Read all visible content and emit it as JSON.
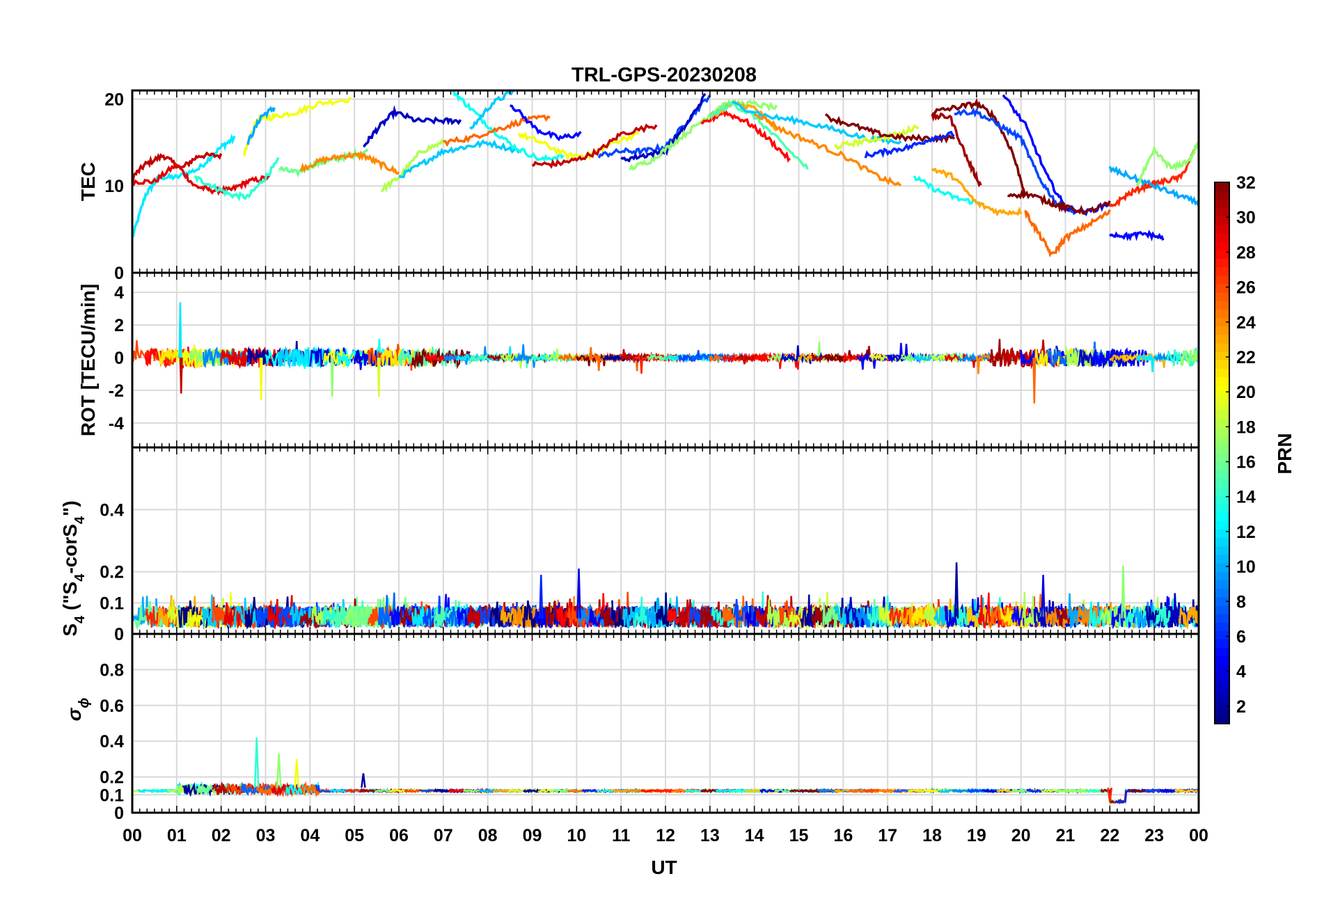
{
  "figure": {
    "title": "TRL-GPS-20230208",
    "xlabel": "UT"
  },
  "colorbar": {
    "label": "PRN",
    "ticks": [
      "2",
      "4",
      "6",
      "8",
      "10",
      "12",
      "14",
      "16",
      "18",
      "20",
      "22",
      "24",
      "26",
      "28",
      "30",
      "32"
    ],
    "min": 1,
    "max": 32,
    "colormap": "jet"
  },
  "x_ticks": [
    "00",
    "01",
    "02",
    "03",
    "04",
    "05",
    "06",
    "07",
    "08",
    "09",
    "10",
    "11",
    "12",
    "13",
    "14",
    "15",
    "16",
    "17",
    "18",
    "19",
    "20",
    "21",
    "22",
    "23",
    "00"
  ],
  "panels": [
    {
      "id": "tec",
      "ylabel": "TEC",
      "ylim": [
        0,
        21
      ],
      "yticks": [
        "0",
        "10",
        "20"
      ]
    },
    {
      "id": "rot",
      "ylabel": "ROT [TECU/min]",
      "ylim": [
        -5.5,
        5.2
      ],
      "yticks": [
        "-4",
        "-2",
        "0",
        "2",
        "4"
      ]
    },
    {
      "id": "s4",
      "ylabel_main": "S",
      "ylabel_sub": "4",
      "ylabel_rest": " (\"S",
      "ylabel_sub2": "4",
      "ylabel_rest2": "-corS",
      "ylabel_sub3": "4",
      "ylabel_end": "\")",
      "ylim": [
        0,
        0.6
      ],
      "yticks": [
        "0",
        "0.1",
        "0.2",
        "0.4"
      ]
    },
    {
      "id": "sigma",
      "ylabel": "σ",
      "ylabel_sub": "ϕ",
      "ylim": [
        0,
        1.0
      ],
      "yticks": [
        "0",
        "0.1",
        "0.2",
        "0.4",
        "0.6",
        "0.8"
      ]
    }
  ],
  "chart_data": [
    {
      "type": "line",
      "panel": "TEC",
      "xlabel": "",
      "ylabel": "TEC",
      "xlim": [
        0,
        24
      ],
      "ylim": [
        0,
        21
      ],
      "series": [
        {
          "prn": 12,
          "x": [
            0,
            0.3,
            0.6,
            1.0,
            1.5,
            2.0,
            2.3
          ],
          "values": [
            4,
            9,
            11,
            11,
            12,
            14.5,
            15.5
          ]
        },
        {
          "prn": 30,
          "x": [
            0,
            0.3,
            0.7,
            1.1,
            1.5,
            2.0
          ],
          "values": [
            11,
            12.5,
            13.5,
            12,
            13.5,
            13.5
          ]
        },
        {
          "prn": 29,
          "x": [
            0,
            0.5,
            1.0,
            1.4,
            1.8,
            2.2,
            2.6,
            3.1
          ],
          "values": [
            10.5,
            10.5,
            12.5,
            10,
            9.5,
            9.5,
            10.5,
            11
          ]
        },
        {
          "prn": 14,
          "x": [
            1.4,
            1.8,
            2.2,
            2.6,
            3.0,
            3.3
          ],
          "values": [
            11,
            10,
            9,
            8.7,
            11,
            13
          ]
        },
        {
          "prn": 20,
          "x": [
            2.5,
            2.8,
            3.2,
            3.7,
            4.2,
            4.9
          ],
          "values": [
            13.5,
            17.5,
            18,
            18.5,
            19.5,
            20
          ]
        },
        {
          "prn": 10,
          "x": [
            2.6,
            2.9,
            3.2
          ],
          "values": [
            15,
            18,
            19
          ]
        },
        {
          "prn": 16,
          "x": [
            3.3,
            3.7,
            4.1,
            4.5,
            4.9,
            5.3
          ],
          "values": [
            12,
            11.5,
            12.5,
            13,
            13.5,
            14
          ]
        },
        {
          "prn": 24,
          "x": [
            3.8,
            4.3,
            4.8,
            5.2,
            5.6,
            6.0
          ],
          "values": [
            12,
            13,
            13.5,
            13.5,
            12.5,
            11.5
          ]
        },
        {
          "prn": 3,
          "x": [
            5.2,
            5.5,
            5.9,
            6.4,
            7.0,
            7.4
          ],
          "values": [
            14.5,
            16.5,
            18.5,
            17.5,
            17.5,
            17.5
          ]
        },
        {
          "prn": 18,
          "x": [
            5.6,
            6.0,
            6.5,
            7.0
          ],
          "values": [
            9.5,
            11,
            14,
            15
          ]
        },
        {
          "prn": 11,
          "x": [
            6.0,
            6.5,
            7.0,
            7.5,
            8.0,
            8.7
          ],
          "values": [
            11,
            12.5,
            14,
            14.5,
            15,
            14
          ]
        },
        {
          "prn": 13,
          "x": [
            7.2,
            7.6,
            8.1,
            8.6,
            9.2,
            9.7
          ],
          "values": [
            21,
            19,
            16.5,
            14.5,
            13,
            13.5
          ]
        },
        {
          "prn": 11,
          "x": [
            7.6,
            8.1,
            8.6
          ],
          "values": [
            16.5,
            19.5,
            21
          ]
        },
        {
          "prn": 25,
          "x": [
            7.0,
            7.6,
            8.2,
            8.8,
            9.4
          ],
          "values": [
            15,
            15.5,
            16.5,
            17.5,
            18
          ]
        },
        {
          "prn": 20,
          "x": [
            8.7,
            9.2,
            9.8,
            10.3,
            10.8,
            11.4
          ],
          "values": [
            16,
            15,
            13.5,
            13.5,
            15,
            16
          ]
        },
        {
          "prn": 30,
          "x": [
            9.0,
            9.5,
            10.0,
            10.5,
            11.0,
            11.8
          ],
          "values": [
            12.5,
            12.5,
            13,
            14,
            16,
            17
          ]
        },
        {
          "prn": 5,
          "x": [
            8.5,
            9.1,
            9.6,
            10.1
          ],
          "values": [
            19.5,
            16.5,
            15.5,
            16
          ]
        },
        {
          "prn": 7,
          "x": [
            10.5,
            11.0,
            11.5,
            12.0,
            12.5,
            13.0
          ],
          "values": [
            13.5,
            14,
            14,
            14.5,
            17.5,
            20.5
          ]
        },
        {
          "prn": 3,
          "x": [
            11.0,
            11.5,
            12.0,
            12.4,
            12.9
          ],
          "values": [
            13,
            13.5,
            14,
            16.5,
            20.5
          ]
        },
        {
          "prn": 17,
          "x": [
            11.2,
            11.7,
            12.2,
            12.7,
            13.3,
            13.9,
            14.5
          ],
          "values": [
            12,
            13,
            15,
            17,
            19.5,
            19.5,
            19
          ]
        },
        {
          "prn": 28,
          "x": [
            12.8,
            13.3,
            13.8,
            14.3,
            14.8
          ],
          "values": [
            17,
            18.5,
            17.5,
            15.5,
            13
          ]
        },
        {
          "prn": 23,
          "x": [
            13.0,
            13.5,
            14.0,
            14.5
          ],
          "values": [
            18,
            19.5,
            19,
            16.5
          ]
        },
        {
          "prn": 15,
          "x": [
            13.0,
            13.5,
            14.0,
            14.6,
            15.2
          ],
          "values": [
            18,
            19.5,
            18,
            15,
            12
          ]
        },
        {
          "prn": 11,
          "x": [
            13.5,
            14.3,
            15.0,
            15.8,
            16.5,
            17.3
          ],
          "values": [
            19.5,
            18,
            17.5,
            16.5,
            15.5,
            15
          ]
        },
        {
          "prn": 24,
          "x": [
            14.0,
            14.6,
            15.3,
            16.0,
            16.8,
            17.3
          ],
          "values": [
            18.5,
            16.5,
            15,
            13.5,
            11,
            10
          ]
        },
        {
          "prn": 19,
          "x": [
            15.8,
            16.3,
            16.8,
            17.3,
            17.7
          ],
          "values": [
            14.5,
            15,
            15.5,
            16,
            17
          ]
        },
        {
          "prn": 32,
          "x": [
            15.6,
            16.2,
            16.8,
            17.4,
            18.0,
            18.5
          ],
          "values": [
            18,
            17,
            16,
            15.5,
            15.5,
            15.5
          ]
        },
        {
          "prn": 6,
          "x": [
            16.5,
            17.0,
            17.5,
            18.0,
            18.5
          ],
          "values": [
            13.5,
            14,
            14.5,
            15.5,
            16
          ]
        },
        {
          "prn": 13,
          "x": [
            17.6,
            18.1,
            18.6,
            19.1
          ],
          "values": [
            11,
            9.5,
            8.5,
            8
          ]
        },
        {
          "prn": 32,
          "x": [
            18.0,
            18.5,
            19.0,
            19.4,
            19.8,
            20.1
          ],
          "values": [
            18.5,
            19,
            19.5,
            18,
            14,
            9
          ]
        },
        {
          "prn": 31,
          "x": [
            18.0,
            18.4,
            18.8,
            19.1
          ],
          "values": [
            18,
            18,
            13,
            10
          ]
        },
        {
          "prn": 23,
          "x": [
            18.0,
            18.5,
            19.0,
            19.5,
            20.0
          ],
          "values": [
            12,
            11,
            8,
            7,
            7
          ]
        },
        {
          "prn": 7,
          "x": [
            18.5,
            19.0,
            19.5,
            20.0,
            20.4,
            20.8,
            21.2
          ],
          "values": [
            18.5,
            18.5,
            17,
            15.5,
            11,
            8,
            7
          ]
        },
        {
          "prn": 5,
          "x": [
            19.6,
            20.1,
            20.6,
            21.0,
            21.5,
            22.0
          ],
          "values": [
            20.5,
            17,
            11,
            7.5,
            7,
            8
          ]
        },
        {
          "prn": 25,
          "x": [
            20.1,
            20.4,
            20.7,
            21.0,
            21.5,
            22.0
          ],
          "values": [
            7,
            4.5,
            2,
            4,
            5.5,
            7
          ]
        },
        {
          "prn": 32,
          "x": [
            19.7,
            20.2,
            20.7,
            21.0,
            21.5,
            22.0
          ],
          "values": [
            9,
            9,
            8,
            7.5,
            7,
            8
          ]
        },
        {
          "prn": 27,
          "x": [
            22.0,
            22.4,
            22.8,
            23.2,
            23.6,
            24.0
          ],
          "values": [
            7.5,
            9,
            10,
            10.5,
            11,
            15
          ]
        },
        {
          "prn": 10,
          "x": [
            22.0,
            22.5,
            23.0,
            23.5,
            24.0
          ],
          "values": [
            12,
            11,
            10,
            9,
            8
          ]
        },
        {
          "prn": 17,
          "x": [
            22.6,
            23.0,
            23.4,
            23.8,
            24.0
          ],
          "values": [
            10,
            14,
            12,
            13,
            15
          ]
        },
        {
          "prn": 5,
          "x": [
            22.0,
            22.4,
            22.8,
            23.2
          ],
          "values": [
            4.5,
            4.2,
            4.5,
            4
          ]
        }
      ]
    },
    {
      "type": "line",
      "panel": "ROT",
      "xlabel": "",
      "ylabel": "ROT [TECU/min]",
      "xlim": [
        0,
        24
      ],
      "ylim": [
        -5.5,
        5.2
      ],
      "note_spikes": [
        [
          1.08,
          3.4
        ],
        [
          1.1,
          -2.2
        ],
        [
          2.9,
          -2.6
        ],
        [
          4.5,
          -2.4
        ],
        [
          5.55,
          -2.4
        ],
        [
          20.3,
          -2.8
        ]
      ]
    },
    {
      "type": "line",
      "panel": "S4",
      "xlabel": "",
      "xlim": [
        0,
        24
      ],
      "ylim": [
        0,
        0.6
      ],
      "typical_range": [
        0.0,
        0.12
      ],
      "peaks": [
        [
          10.05,
          0.21
        ],
        [
          18.55,
          0.23
        ],
        [
          22.3,
          0.22
        ],
        [
          20.5,
          0.19
        ],
        [
          9.2,
          0.19
        ]
      ]
    },
    {
      "type": "line",
      "panel": "sigma_phi",
      "xlabel": "UT",
      "xlim": [
        0,
        24
      ],
      "ylim": [
        0,
        1.0
      ],
      "baseline": 0.12,
      "peaks": [
        [
          2.8,
          0.42
        ],
        [
          3.3,
          0.33
        ],
        [
          3.7,
          0.3
        ],
        [
          5.2,
          0.22
        ],
        [
          22.0,
          0.06
        ]
      ]
    }
  ]
}
